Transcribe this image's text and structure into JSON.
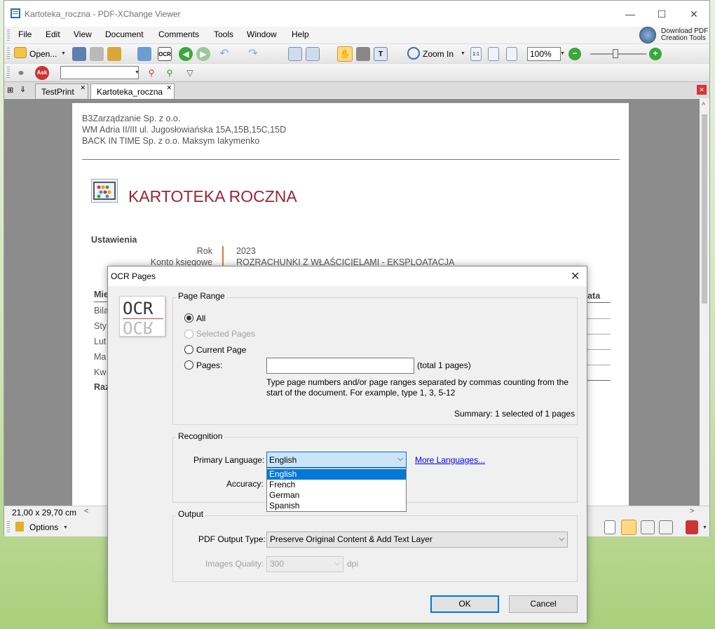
{
  "window": {
    "title": "Kartoteka_roczna - PDF-XChange Viewer",
    "minimize": "—",
    "maximize": "☐",
    "close": "✕"
  },
  "menu": [
    "File",
    "Edit",
    "View",
    "Document",
    "Comments",
    "Tools",
    "Window",
    "Help"
  ],
  "promo": {
    "line1": "Download PDF",
    "line2": "Creation Tools"
  },
  "toolbar": {
    "open_label": "Open...",
    "ocr_label": "OCR",
    "zoom_in_label": "Zoom In",
    "zoom_value": "100%",
    "fit_label": "1:1"
  },
  "tabs": [
    {
      "label": "TestPrint"
    },
    {
      "label": "Kartoteka_roczna"
    }
  ],
  "document": {
    "header_lines": [
      "B3Zarządzanie Sp. z o.o.",
      "WM Adria II/III ul. Jugosłowiańska 15A,15B,15C,15D",
      "BACK IN TIME Sp. z o.o. Maksym Iakymenko"
    ],
    "title": "KARTOTEKA ROCZNA",
    "settings_heading": "Ustawienia",
    "rows": [
      {
        "label": "Rok",
        "value": "2023"
      },
      {
        "label": "Konto księgowe",
        "value": "ROZRACHUNKI Z WŁAŚCICIELAMI - EKSPLOATACJA"
      }
    ],
    "table_left": [
      "Mie",
      "Bila",
      "Sty",
      "Lut",
      "Ma",
      "Kw",
      "Raz"
    ],
    "table_right_header": "płata"
  },
  "status": {
    "page_size": "21,00 x 29,70 cm"
  },
  "bottom": {
    "options_label": "Options"
  },
  "dialog": {
    "title": "OCR Pages",
    "ocr_logo": "OCR",
    "page_range": {
      "title": "Page Range",
      "all": "All",
      "selected_pages": "Selected Pages",
      "current_page": "Current Page",
      "pages": "Pages:",
      "pages_value": "",
      "total": "(total 1 pages)",
      "hint": "Type page numbers and/or page ranges separated by commas counting from the start of the document. For example, type 1, 3, 5-12",
      "summary": "Summary: 1 selected of 1 pages"
    },
    "recognition": {
      "title": "Recognition",
      "primary_language_label": "Primary Language:",
      "primary_language_value": "English",
      "more_languages": "More Languages...",
      "accuracy_label": "Accuracy:",
      "language_options": [
        "English",
        "French",
        "German",
        "Spanish"
      ]
    },
    "output": {
      "title": "Output",
      "type_label": "PDF Output Type:",
      "type_value": "Preserve Original Content & Add Text Layer",
      "quality_label": "Images Quality:",
      "quality_value": "300",
      "quality_unit": "dpi"
    },
    "ok": "OK",
    "cancel": "Cancel"
  },
  "colors": {
    "accent": "#0078d7",
    "title_red": "#9b2335",
    "link": "#0000ee"
  }
}
